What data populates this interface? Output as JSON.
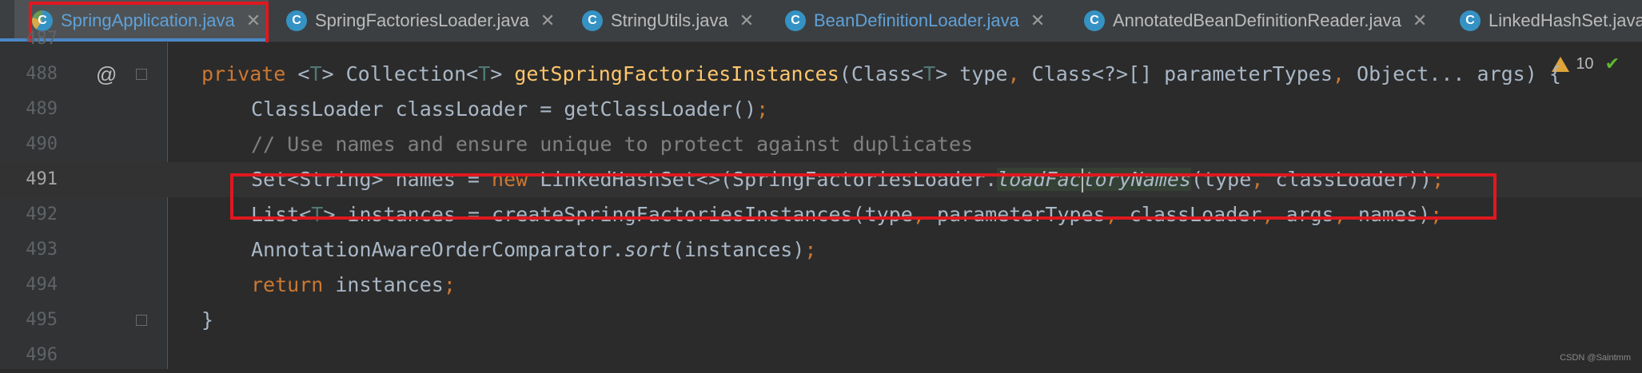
{
  "tabs": [
    {
      "label": "SpringApplication.java",
      "active": true
    },
    {
      "label": "SpringFactoriesLoader.java"
    },
    {
      "label": "StringUtils.java"
    },
    {
      "label": "BeanDefinitionLoader.java"
    },
    {
      "label": "AnnotatedBeanDefinitionReader.java"
    },
    {
      "label": "LinkedHashSet.java"
    }
  ],
  "editor": {
    "warnings_count": "10",
    "line_numbers": [
      "487",
      "488",
      "489",
      "490",
      "491",
      "492",
      "493",
      "494",
      "495",
      "496"
    ],
    "annotation_marker": "@"
  },
  "watermark": "CSDN @Saintmm",
  "colors": {
    "keyword": "#cc7832",
    "function": "#ffc66d",
    "comment": "#808080",
    "highlight_box": "#e0181f"
  }
}
